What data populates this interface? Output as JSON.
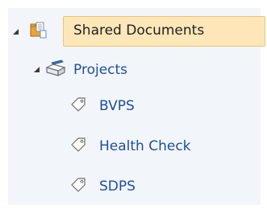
{
  "tree": {
    "root": {
      "label": "Shared Documents",
      "icon": "folder-documents-icon",
      "expanded": true,
      "selected": true
    },
    "folder": {
      "label": "Projects",
      "icon": "folder-pen-icon",
      "expanded": true
    },
    "items": [
      {
        "label": "BVPS",
        "icon": "tag-icon"
      },
      {
        "label": "Health Check",
        "icon": "tag-icon"
      },
      {
        "label": "SDPS",
        "icon": "tag-icon"
      }
    ]
  },
  "colors": {
    "panel_bg": "#f2f6fb",
    "selected_bg": "#fde7b8",
    "selected_border": "#efc27a",
    "link_text": "#1f4e9b",
    "root_text": "#222222"
  }
}
